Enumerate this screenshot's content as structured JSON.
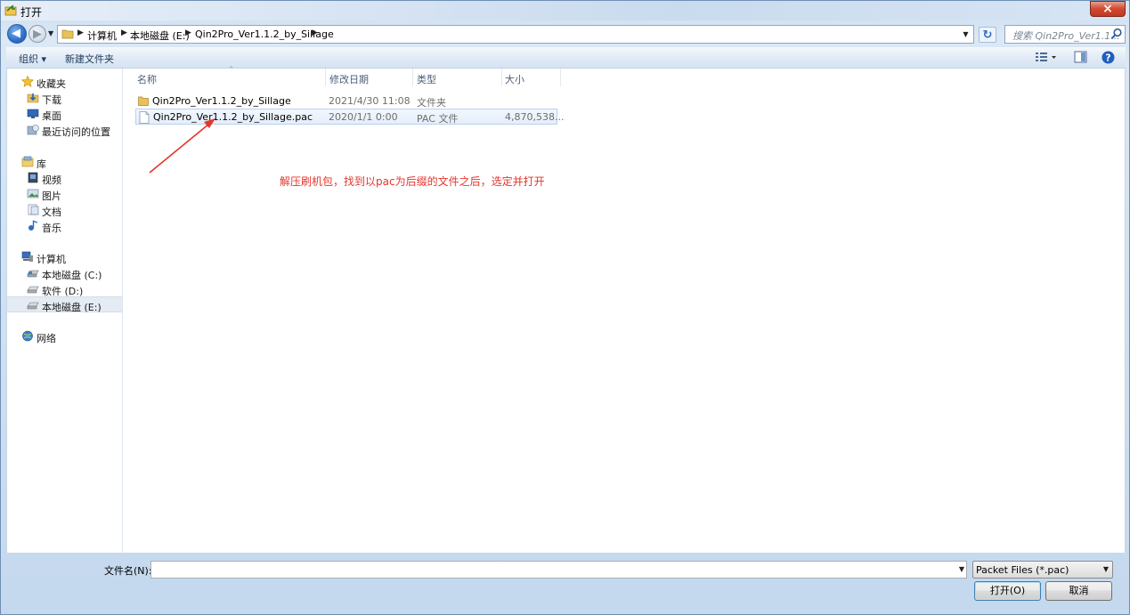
{
  "window": {
    "title": "打开",
    "close_label": "×"
  },
  "address": {
    "crumbs": [
      "计算机",
      "本地磁盘 (E:)",
      "Qin2Pro_Ver1.1.2_by_Sillage"
    ]
  },
  "search": {
    "placeholder": "搜索 Qin2Pro_Ver1.1..."
  },
  "toolbar": {
    "organize_label": "组织 ▾",
    "new_folder_label": "新建文件夹"
  },
  "sidebar": {
    "items": [
      {
        "label": "收藏夹",
        "icon": "star-icon"
      },
      {
        "label": "下载",
        "icon": "download-folder-icon"
      },
      {
        "label": "桌面",
        "icon": "desktop-icon"
      },
      {
        "label": "最近访问的位置",
        "icon": "recent-places-icon"
      },
      {
        "label": "库",
        "icon": "library-icon"
      },
      {
        "label": "视频",
        "icon": "video-icon"
      },
      {
        "label": "图片",
        "icon": "pictures-icon"
      },
      {
        "label": "文档",
        "icon": "documents-icon"
      },
      {
        "label": "音乐",
        "icon": "music-icon"
      },
      {
        "label": "计算机",
        "icon": "computer-icon"
      },
      {
        "label": "本地磁盘 (C:)",
        "icon": "drive-icon"
      },
      {
        "label": "软件 (D:)",
        "icon": "drive-icon"
      },
      {
        "label": "本地磁盘 (E:)",
        "icon": "drive-icon"
      },
      {
        "label": "网络",
        "icon": "network-icon"
      }
    ]
  },
  "columns": {
    "name": "名称",
    "modified": "修改日期",
    "type": "类型",
    "size": "大小"
  },
  "files": [
    {
      "name": "Qin2Pro_Ver1.1.2_by_Sillage",
      "modified": "2021/4/30 11:08",
      "type": "文件夹",
      "size": ""
    },
    {
      "name": "Qin2Pro_Ver1.1.2_by_Sillage.pac",
      "modified": "2020/1/1 0:00",
      "type": "PAC 文件",
      "size": "4,870,538..."
    }
  ],
  "annotation": {
    "text": "解压刷机包，找到以pac为后缀的文件之后，选定并打开",
    "color": "#e5352c"
  },
  "footer": {
    "filename_label": "文件名(N):",
    "filename_value": "",
    "filter_selected": "Packet Files (*.pac)",
    "open_label": "打开(O)",
    "cancel_label": "取消"
  }
}
